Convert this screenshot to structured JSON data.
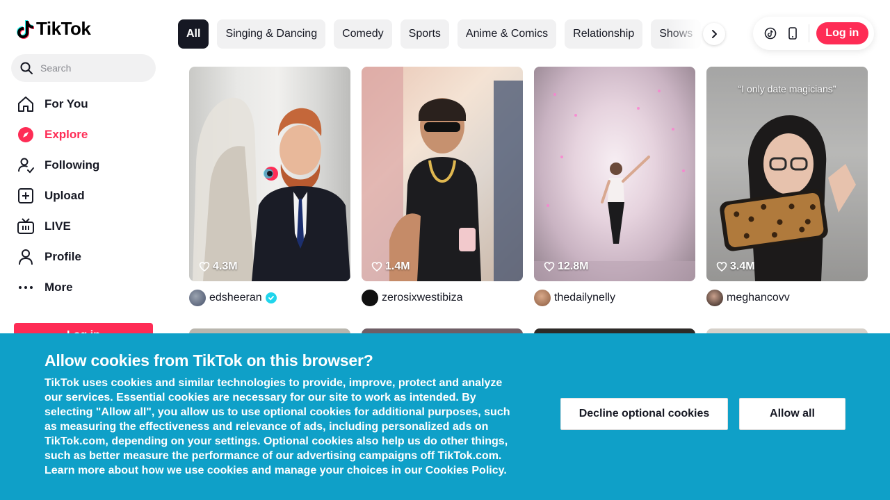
{
  "app": {
    "logo_text": "TikTok"
  },
  "search": {
    "placeholder": "Search"
  },
  "sidebar": {
    "items": [
      {
        "label": "For You",
        "icon": "home-icon",
        "active": false
      },
      {
        "label": "Explore",
        "icon": "compass-icon",
        "active": true
      },
      {
        "label": "Following",
        "icon": "following-icon",
        "active": false
      },
      {
        "label": "Upload",
        "icon": "upload-icon",
        "active": false
      },
      {
        "label": "LIVE",
        "icon": "live-icon",
        "active": false
      },
      {
        "label": "Profile",
        "icon": "profile-icon",
        "active": false
      },
      {
        "label": "More",
        "icon": "more-icon",
        "active": false
      }
    ],
    "login_label": "Log in"
  },
  "categories": [
    "All",
    "Singing & Dancing",
    "Comedy",
    "Sports",
    "Anime & Comics",
    "Relationship",
    "Shows"
  ],
  "header": {
    "login_label": "Log in",
    "icons": [
      "tiktok-coin-icon",
      "mobile-app-icon"
    ]
  },
  "videos": [
    {
      "likes": "4.3M",
      "author": "edsheeran",
      "verified": true,
      "overlay": ""
    },
    {
      "likes": "1.4M",
      "author": "zerosixwestibiza",
      "verified": false,
      "overlay": ""
    },
    {
      "likes": "12.8M",
      "author": "thedailynelly",
      "verified": false,
      "overlay": ""
    },
    {
      "likes": "3.4M",
      "author": "meghancovv",
      "verified": false,
      "overlay": "“I only date magicians”"
    }
  ],
  "cookie": {
    "title": "Allow cookies from TikTok on this browser?",
    "body": "TikTok uses cookies and similar technologies to provide, improve, protect and analyze our services. Essential cookies are necessary for our site to work as intended. By selecting \"Allow all\", you allow us to use optional cookies for additional purposes, such as measuring the effectiveness and relevance of ads, including personalized ads on TikTok.com, depending on your settings. Optional cookies also help us do other things, such as better measure the performance of our advertising campaigns off TikTok.com. Learn more about how we use cookies and manage your choices in our ",
    "link_text": "Cookies Policy",
    "body_end": ".",
    "decline_label": "Decline optional cookies",
    "allow_label": "Allow all"
  },
  "colors": {
    "brand": "#fe2c55",
    "banner": "#0fa0c8",
    "verified": "#20d5ec"
  }
}
